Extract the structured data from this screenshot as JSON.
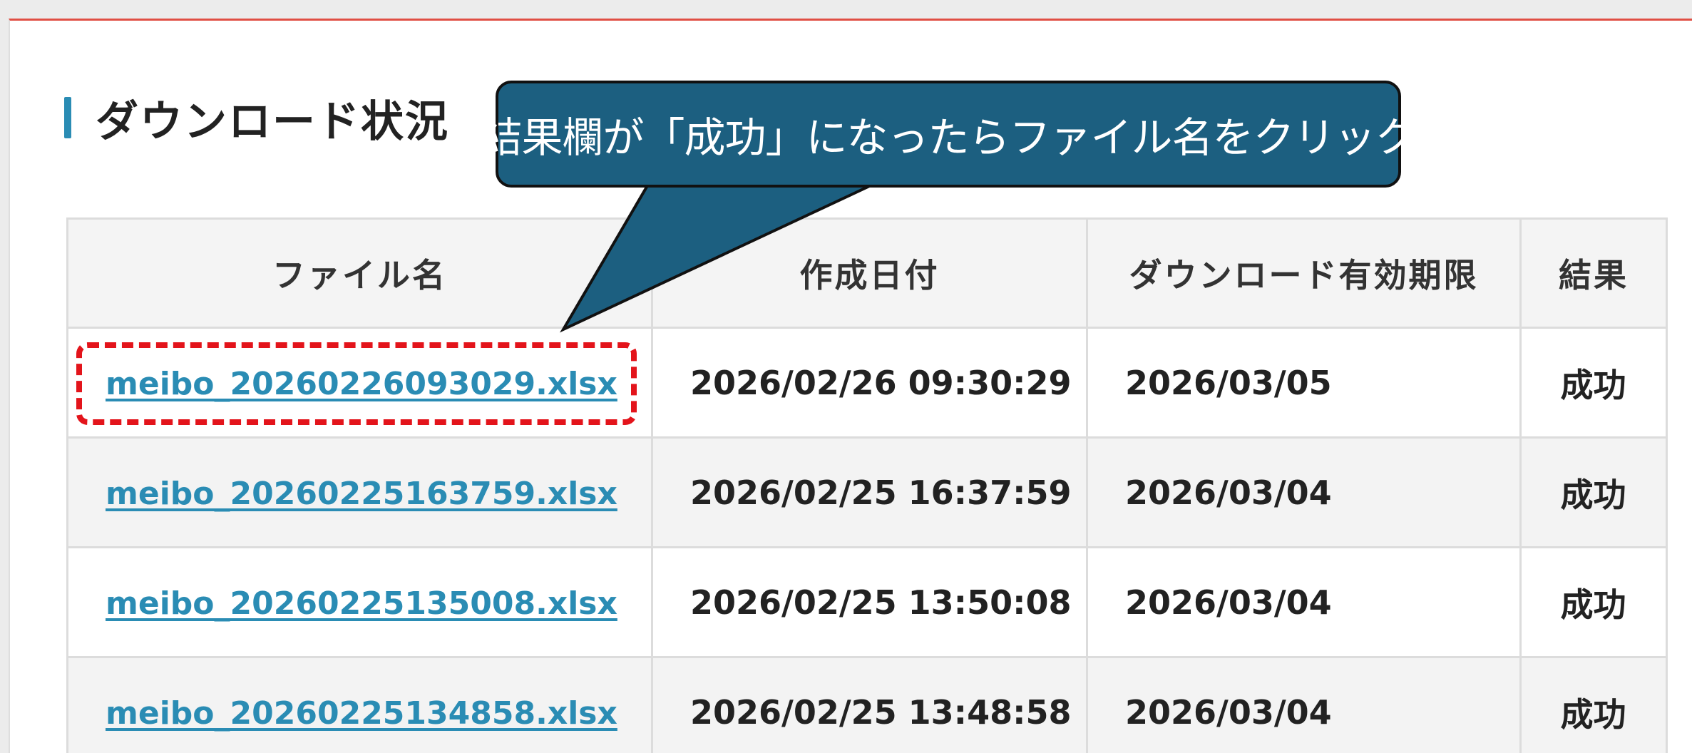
{
  "section": {
    "heading": "ダウンロード状況"
  },
  "callout": {
    "text": "結果欄が「成功」になったらファイル名をクリック"
  },
  "table": {
    "headers": [
      "ファイル名",
      "作成日付",
      "ダウンロード有効期限",
      "結果"
    ],
    "rows": [
      {
        "file": "meibo_20260226093029.xlsx",
        "created": "2026/02/26 09:30:29",
        "expires": "2026/03/05",
        "result": "成功"
      },
      {
        "file": "meibo_20260225163759.xlsx",
        "created": "2026/02/25 16:37:59",
        "expires": "2026/03/04",
        "result": "成功"
      },
      {
        "file": "meibo_20260225135008.xlsx",
        "created": "2026/02/25 13:50:08",
        "expires": "2026/03/04",
        "result": "成功"
      },
      {
        "file": "meibo_20260225134858.xlsx",
        "created": "2026/02/25 13:48:58",
        "expires": "2026/03/04",
        "result": "成功"
      }
    ]
  },
  "colors": {
    "accent_bar": "#2a8cb4",
    "link": "#2a8cb4",
    "top_rule": "#e04f44",
    "callout_bg": "#1c5f80",
    "highlight": "#e3141b"
  }
}
